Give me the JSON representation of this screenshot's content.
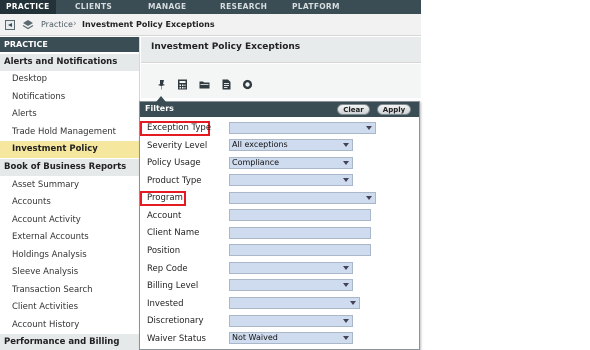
{
  "topnav": {
    "tabs": [
      {
        "label": "PRACTICE"
      },
      {
        "label": "CLIENTS"
      },
      {
        "label": "MANAGE"
      },
      {
        "label": "RESEARCH"
      },
      {
        "label": "PLATFORM"
      }
    ]
  },
  "breadcrumb": {
    "items": [
      "Practice",
      "Investment Policy Exceptions"
    ],
    "separator": "›"
  },
  "sidebar": {
    "header": "PRACTICE",
    "sections": [
      {
        "label": "Alerts and Notifications"
      },
      {
        "label": "Book of Business Reports"
      },
      {
        "label": "Performance and Billing"
      }
    ],
    "items": [
      {
        "label": "Desktop"
      },
      {
        "label": "Notifications"
      },
      {
        "label": "Alerts"
      },
      {
        "label": "Trade Hold Management"
      },
      {
        "label": "Investment Policy Exceptions"
      },
      {
        "label": "Asset Summary"
      },
      {
        "label": "Accounts"
      },
      {
        "label": "Account Activity"
      },
      {
        "label": "External Accounts"
      },
      {
        "label": "Holdings Analysis"
      },
      {
        "label": "Sleeve Analysis"
      },
      {
        "label": "Transaction Search"
      },
      {
        "label": "Client Activities"
      },
      {
        "label": "Account History"
      }
    ]
  },
  "main": {
    "title": "Investment Policy Exceptions",
    "toolbar_icons": [
      "pin-icon",
      "calculator-icon",
      "folder-icon",
      "document-icon",
      "settings-circle-icon"
    ]
  },
  "filters": {
    "title": "Filters",
    "clear_label": "Clear",
    "apply_label": "Apply",
    "rows": [
      {
        "label": "Exception Type",
        "value": "",
        "control": "dropdown",
        "highlighted": true
      },
      {
        "label": "Severity Level",
        "value": "All exceptions",
        "control": "dropdown"
      },
      {
        "label": "Policy Usage",
        "value": "Compliance",
        "control": "dropdown"
      },
      {
        "label": "Product Type",
        "value": "",
        "control": "dropdown"
      },
      {
        "label": "Program",
        "value": "",
        "control": "dropdown",
        "highlighted": true
      },
      {
        "label": "Account",
        "value": "",
        "control": "text"
      },
      {
        "label": "Client Name",
        "value": "",
        "control": "text"
      },
      {
        "label": "Position",
        "value": "",
        "control": "text"
      },
      {
        "label": "Rep Code",
        "value": "",
        "control": "dropdown"
      },
      {
        "label": "Billing Level",
        "value": "",
        "control": "dropdown"
      },
      {
        "label": "Invested",
        "value": "",
        "control": "dropdown"
      },
      {
        "label": "Discretionary",
        "value": "",
        "control": "dropdown"
      },
      {
        "label": "Waiver Status",
        "value": "Not Waived",
        "control": "dropdown"
      }
    ]
  },
  "colors": {
    "nav_bg": "#3a4d54",
    "active_item_bg": "#f6e79f",
    "field_bg": "#cfdbee",
    "highlight_red": "#e51b24"
  }
}
